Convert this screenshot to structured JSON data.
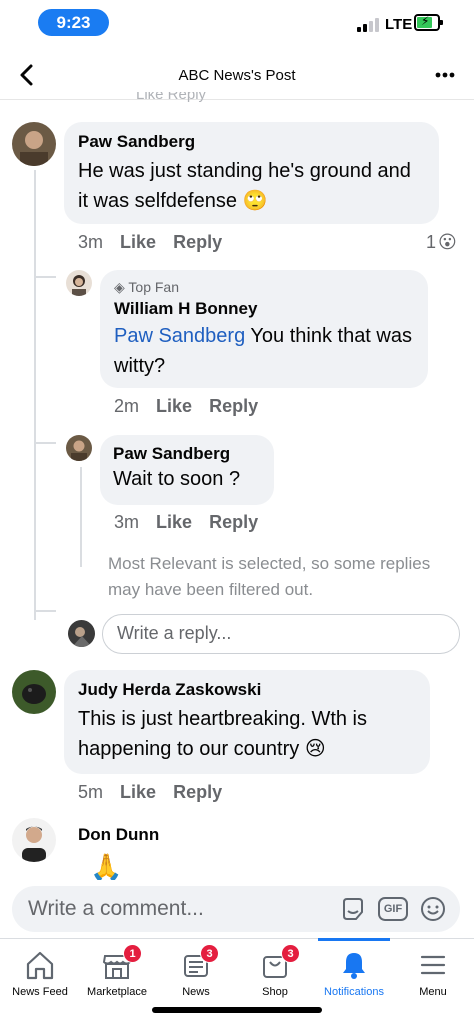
{
  "status": {
    "time": "9:23",
    "network": "LTE"
  },
  "header": {
    "title": "ABC News's Post",
    "partial_text": "Like Reply"
  },
  "comments": [
    {
      "author": "Paw Sandberg",
      "text": "He was just standing he's ground and it was selfdefense 🙄",
      "time": "3m",
      "like": "Like",
      "reply": "Reply",
      "reactions": "1"
    },
    {
      "badge": "Top Fan",
      "author": "William H Bonney",
      "mention": "Paw Sandberg",
      "text": " You think that was witty?",
      "time": "2m",
      "like": "Like",
      "reply": "Reply"
    },
    {
      "author": "Paw Sandberg",
      "text": "Wait to soon ?",
      "time": "3m",
      "like": "Like",
      "reply": "Reply"
    },
    {
      "author": "Judy Herda Zaskowski",
      "text": "This is just heartbreaking. Wth is happening to our country 😢",
      "time": "5m",
      "like": "Like",
      "reply": "Reply"
    },
    {
      "author": "Don Dunn",
      "text": "🙏"
    }
  ],
  "notice": "Most Relevant is selected, so some replies may have been filtered out.",
  "reply_placeholder": "Write a reply...",
  "comment_placeholder": "Write a comment...",
  "gif_label": "GIF",
  "tabs": [
    {
      "label": "News Feed",
      "icon": "home-icon"
    },
    {
      "label": "Marketplace",
      "icon": "marketplace-icon",
      "badge": "1"
    },
    {
      "label": "News",
      "icon": "news-icon",
      "badge": "3"
    },
    {
      "label": "Shop",
      "icon": "shop-icon",
      "badge": "3"
    },
    {
      "label": "Notifications",
      "icon": "bell-icon",
      "active": true
    },
    {
      "label": "Menu",
      "icon": "menu-icon"
    }
  ],
  "colors": {
    "accent": "#1877f2",
    "badge": "#e41e3f",
    "bubble": "#f0f2f5",
    "time_pill": "#1a7cf2"
  }
}
